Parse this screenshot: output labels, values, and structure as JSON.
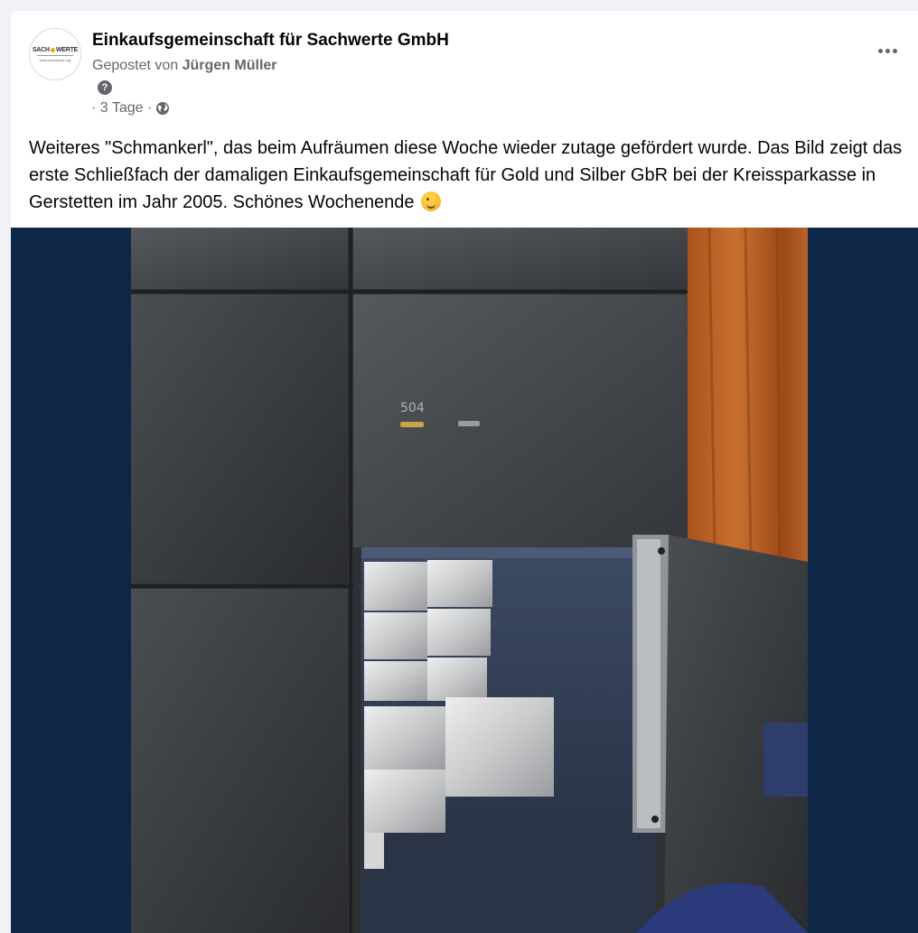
{
  "post": {
    "page_name": "Einkaufsgemeinschaft für Sachwerte GmbH",
    "posted_by_prefix": "Gepostet von ",
    "author": "Jürgen Müller",
    "badge_glyph": "?",
    "meta_time": "· 3 Tage ·",
    "audience_icon": "globe-icon",
    "more_icon": "more-options-icon",
    "text": "Weiteres \"Schmankerl\", das beim Aufräumen diese Woche wieder zutage gefördert wurde. Das Bild zeigt das erste Schließfach der damaligen Einkaufsgemeinschaft für Gold und Silber GbR bei der Kreissparkasse in Gerstetten im Jahr 2005. Schönes Wochenende",
    "emoji": "winking-face-emoji"
  },
  "avatar": {
    "logo_left": "SACH",
    "logo_right": "WERTE",
    "logo_url": "www.sachwerte.org"
  },
  "photo": {
    "box_number": "504"
  },
  "colors": {
    "page_bg": "#f0f2f5",
    "card_bg": "#ffffff",
    "photo_bg": "#0f2747",
    "secondary_text": "#65676b"
  }
}
